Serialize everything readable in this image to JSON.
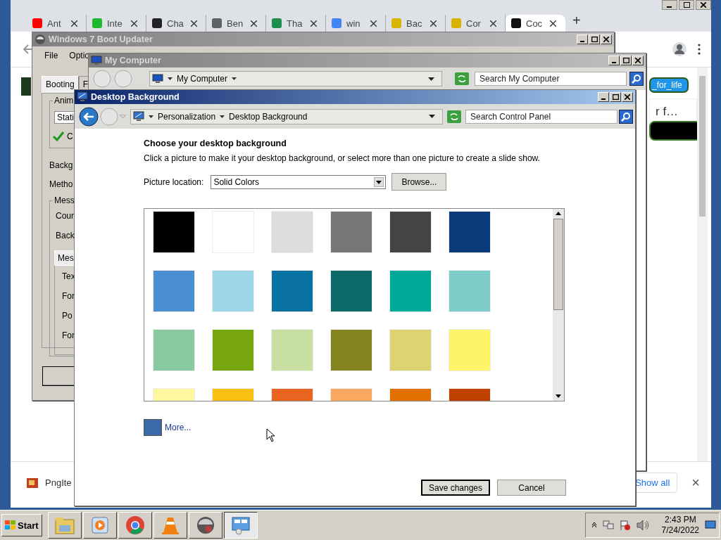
{
  "browser": {
    "tabs": [
      {
        "label": "Ant",
        "color": "#ff0000",
        "selected": false
      },
      {
        "label": "Inte",
        "color": "#1db82b",
        "selected": false
      },
      {
        "label": "Cha",
        "color": "#222222",
        "selected": false
      },
      {
        "label": "Ben",
        "color": "#5f6368",
        "selected": false
      },
      {
        "label": "Tha",
        "color": "#1f8f4e",
        "selected": false
      },
      {
        "label": "win",
        "color": "#4285f4",
        "selected": false
      },
      {
        "label": "Bac",
        "color": "#d8b400",
        "selected": false
      },
      {
        "label": "Cor",
        "color": "#d8b400",
        "selected": false
      },
      {
        "label": "Coc",
        "color": "#111111",
        "selected": true
      }
    ],
    "new_tab": "+",
    "page": {
      "tag_button": "_for_life",
      "text": "r f…"
    },
    "download_bar": {
      "file": "PngIte",
      "show_all": "Show all",
      "close": "×"
    }
  },
  "boot_updater": {
    "title": "Windows 7 Boot Updater",
    "menu": [
      "File",
      "Optio"
    ],
    "tabs": [
      {
        "label": "Booting",
        "selected": true
      },
      {
        "label": "F",
        "selected": false
      }
    ],
    "animation_group": "Anim",
    "animation_value": "Stati",
    "checkbox": {
      "label": "C",
      "checked": true
    },
    "labels": [
      "Backg",
      "Metho"
    ],
    "message_group": "Mess",
    "message_labels": [
      "Coun",
      "Back"
    ],
    "inner_tab": "Mes",
    "inner_labels": [
      "Tex",
      "For",
      "Po",
      "For"
    ]
  },
  "my_computer": {
    "title": "My Computer",
    "address": "My Computer",
    "search_placeholder": "Search My Computer"
  },
  "desktop_background": {
    "title": "Desktop Background",
    "breadcrumb": [
      "Personalization",
      "Desktop Background"
    ],
    "search_placeholder": "Search Control Panel",
    "heading": "Choose your desktop background",
    "description": "Click a picture to make it your desktop background, or select more than one picture to create a slide show.",
    "location_label": "Picture location:",
    "location_value": "Solid Colors",
    "browse": "Browse...",
    "swatches": [
      {
        "color": "#000000"
      },
      {
        "color": "#ffffff"
      },
      {
        "color": "#dcdcdc"
      },
      {
        "color": "#777777"
      },
      {
        "color": "#444444"
      },
      {
        "color": "#0a3a7a"
      },
      {
        "color": "#4a90d0"
      },
      {
        "color": "#9dd6e8"
      },
      {
        "color": "#0a72a0"
      },
      {
        "color": "#0d6a68"
      },
      {
        "color": "#00a89a"
      },
      {
        "color": "#7ecdc8"
      },
      {
        "color": "#88c9a0"
      },
      {
        "color": "#76a50c"
      },
      {
        "color": "#c7dfa0"
      },
      {
        "color": "#868420"
      },
      {
        "color": "#dcd470"
      },
      {
        "color": "#fff36a"
      },
      {
        "color": "#fff7a0"
      },
      {
        "color": "#f8c010"
      },
      {
        "color": "#e86420"
      },
      {
        "color": "#f8a860"
      },
      {
        "color": "#e07000"
      },
      {
        "color": "#c04000"
      }
    ],
    "more": {
      "color": "#3a6aa8",
      "label": "More..."
    },
    "buttons": [
      {
        "label": "Save changes",
        "kind": "default"
      },
      {
        "label": "Cancel",
        "kind": "normal"
      }
    ]
  },
  "taskbar": {
    "start": "Start",
    "time": "2:43 PM",
    "date": "7/24/2022"
  }
}
